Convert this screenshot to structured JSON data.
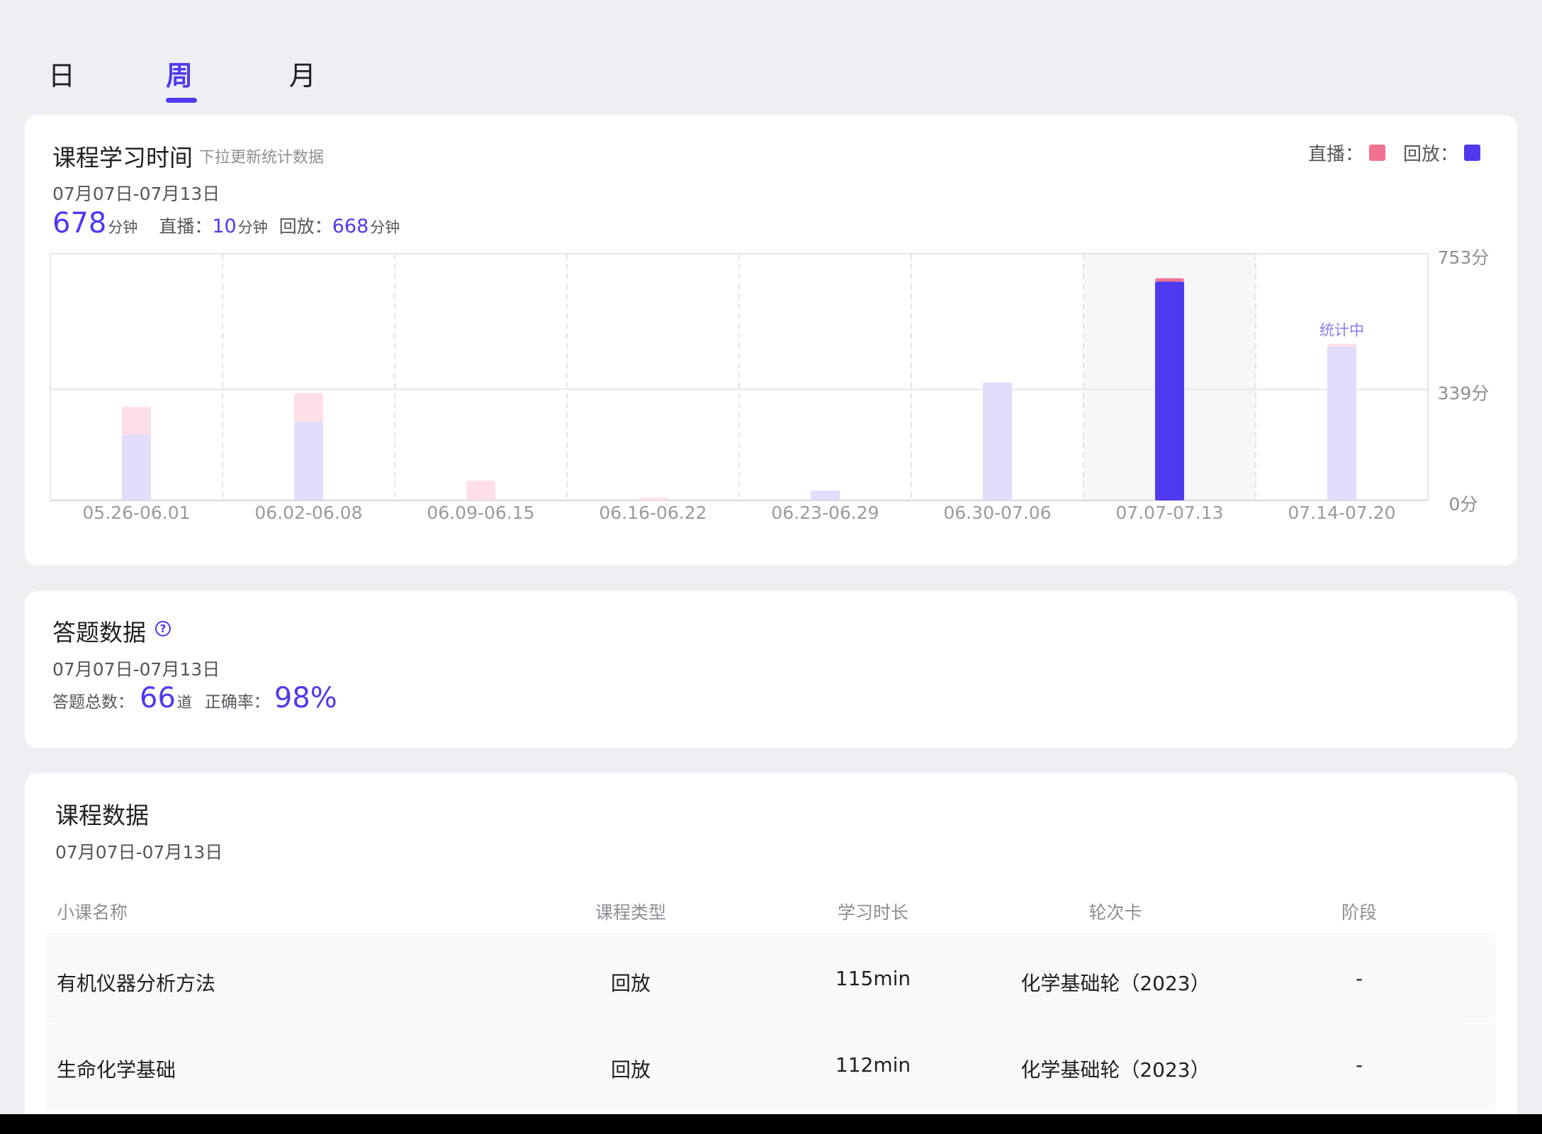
{
  "tabs": [
    {
      "label": "日",
      "active": false
    },
    {
      "label": "周",
      "active": true
    },
    {
      "label": "月",
      "active": false
    }
  ],
  "study_time": {
    "title": "课程学习时间",
    "hint": "下拉更新统计数据",
    "date_range": "07月07日-07月13日",
    "total_value": "678",
    "unit": "分钟",
    "live_label": "直播：",
    "live_value": "10",
    "replay_label": "回放：",
    "replay_value": "668",
    "legend_live": "直播：",
    "legend_replay": "回放：",
    "colors": {
      "live": "#f0728f",
      "replay": "#4f3aef",
      "live_faded": "#ffdfe7",
      "replay_faded": "#e1ddfb"
    }
  },
  "chart_data": {
    "type": "bar",
    "stacked": true,
    "categories": [
      "05.26-06.01",
      "06.02-06.08",
      "06.09-06.15",
      "06.16-06.22",
      "06.23-06.29",
      "06.30-07.06",
      "07.07-07.13",
      "07.14-07.20"
    ],
    "series": [
      {
        "name": "回放",
        "values": [
          200,
          240,
          0,
          0,
          30,
          360,
          668,
          470
        ]
      },
      {
        "name": "直播",
        "values": [
          85,
          88,
          60,
          8,
          0,
          0,
          10,
          8
        ]
      }
    ],
    "y_ticks": [
      "753分",
      "339分",
      "0分"
    ],
    "ylim": [
      0,
      753
    ],
    "highlight_category": "07.07-07.13",
    "in_progress_label": "统计中",
    "grid": true
  },
  "answers": {
    "title": "答题数据",
    "date_range": "07月07日-07月13日",
    "total_label": "答题总数：",
    "total_value": "66",
    "total_unit": "道",
    "accuracy_label": "正确率：",
    "accuracy_value": "98%"
  },
  "courses": {
    "title": "课程数据",
    "date_range": "07月07日-07月13日",
    "headers": [
      "小课名称",
      "课程类型",
      "学习时长",
      "轮次卡",
      "阶段"
    ],
    "rows": [
      {
        "name": "有机仪器分析方法",
        "type": "回放",
        "duration": "115min",
        "round": "化学基础轮（2023）",
        "stage": "-"
      },
      {
        "name": "生命化学基础",
        "type": "回放",
        "duration": "112min",
        "round": "化学基础轮（2023）",
        "stage": "-"
      }
    ]
  }
}
